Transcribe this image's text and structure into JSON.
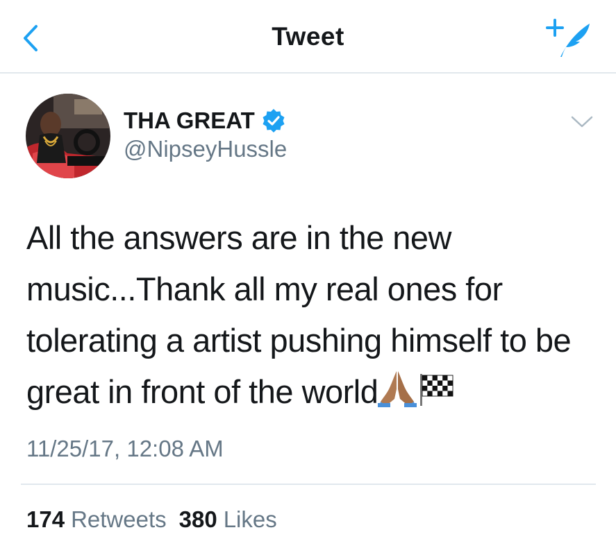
{
  "nav": {
    "title": "Tweet",
    "back_icon": "chevron-left-icon",
    "compose_icon": "compose-feather-icon",
    "accent_color": "#1da1f2"
  },
  "author": {
    "display_name": "THA GREAT",
    "handle": "@NipseyHussle",
    "verified": true
  },
  "tweet": {
    "text": "All the answers are in the new music...Thank all my real ones for tolerating a artist pushing himself to be great in front of the world",
    "emojis": [
      "folded-hands-icon",
      "checkered-flag-icon"
    ],
    "timestamp": "11/25/17, 12:08 AM"
  },
  "stats": {
    "retweets_count": "174",
    "retweets_label": "Retweets",
    "likes_count": "380",
    "likes_label": "Likes"
  }
}
